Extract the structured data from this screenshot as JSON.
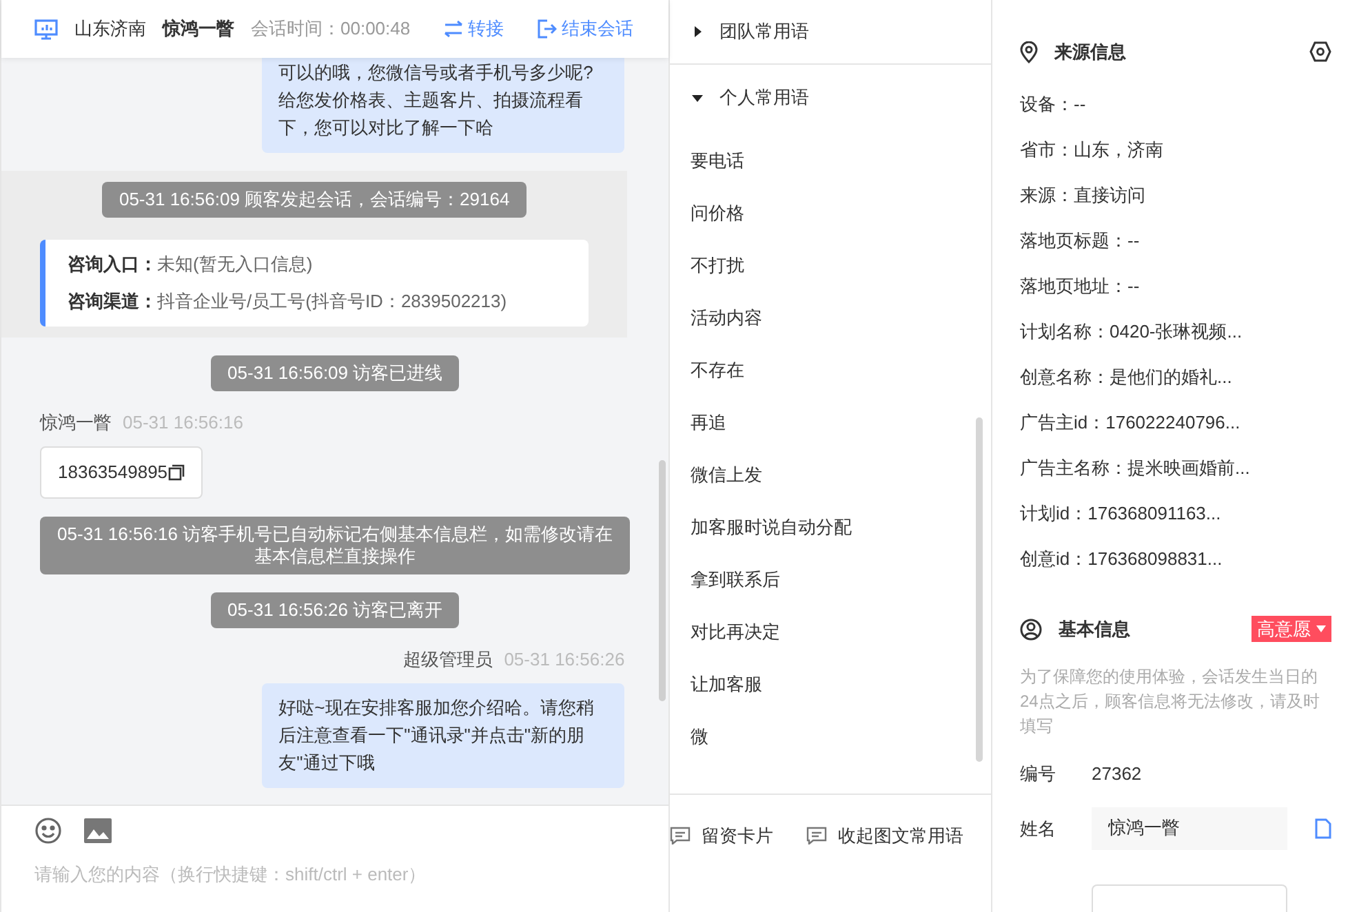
{
  "header": {
    "location": "山东济南",
    "visitor": "惊鸿一瞥",
    "timer_label": "会话时间：",
    "timer": "00:00:48",
    "actions": [
      {
        "label": "转接",
        "kind": "transfer"
      },
      {
        "label": "结束会话",
        "kind": "end"
      }
    ]
  },
  "messages": [
    {
      "kind": "agent",
      "text": "可以的哦，您微信号或者手机号多少呢?给您发价格表、主题客片、拍摄流程看下，您可以对比了解一下哈"
    },
    {
      "kind": "session",
      "notice": "05-31 16:56:09 顾客发起会话，会话编号：29164",
      "fields": [
        {
          "label": "咨询入口：",
          "value": "未知(暂无入口信息)"
        },
        {
          "label": "咨询渠道：",
          "value": "抖音企业号/员工号(抖音号ID：2839502213)"
        }
      ]
    },
    {
      "kind": "notice",
      "text": "05-31 16:56:09 访客已进线"
    },
    {
      "kind": "visitor",
      "name": "惊鸿一瞥",
      "time": "05-31 16:56:16",
      "text": "18363549895"
    },
    {
      "kind": "notice",
      "text": "05-31 16:56:16 访客手机号已自动标记右侧基本信息栏，如需修改请在基本信息栏直接操作"
    },
    {
      "kind": "notice",
      "text": "05-31 16:56:26 访客已离开"
    },
    {
      "kind": "agent",
      "name": "超级管理员",
      "time": "05-31 16:56:26",
      "text": "好哒~现在安排客服加您介绍哈。请您稍后注意查看一下\"通讯录\"并点击\"新的朋友\"通过下哦"
    }
  ],
  "input": {
    "placeholder": "请输入您的内容（换行快捷键：shift/ctrl + enter）"
  },
  "phrases": {
    "groups": [
      {
        "label": "团队常用语",
        "expanded": false
      },
      {
        "label": "个人常用语",
        "expanded": true
      }
    ],
    "items": [
      "要电话",
      "问价格",
      "不打扰",
      "活动内容",
      "不存在",
      "再追",
      "微信上发",
      "加客服时说自动分配",
      "拿到联系后",
      "对比再决定",
      "让加客服",
      "微"
    ],
    "footer": [
      "留资卡片",
      "收起图文常用语"
    ]
  },
  "source_info": {
    "title": "来源信息",
    "rows": [
      "设备：--",
      "省市：山东，济南",
      "来源：直接访问",
      "落地页标题：--",
      "落地页地址：--",
      "计划名称：0420-张琳视频...",
      "创意名称：是他们的婚礼...",
      "广告主id：176022240796...",
      "广告主名称：提米映画婚前...",
      "计划id：176368091163...",
      "创意id：176368098831..."
    ]
  },
  "basic_info": {
    "title": "基本信息",
    "intent": "高意愿",
    "note": "为了保障您的使用体验，会话发生当日的24点之后，顾客信息将无法修改，请及时填写",
    "id_label": "编号",
    "id": "27362",
    "name_label": "姓名",
    "name": "惊鸿一瞥"
  }
}
